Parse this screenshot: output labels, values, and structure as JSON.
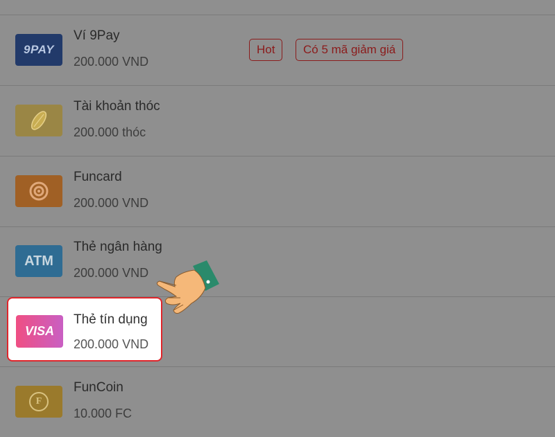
{
  "payment_methods": [
    {
      "name": "Ví 9Pay",
      "amount": "200.000 VND",
      "logo_text": "9PAY",
      "icon": "9pay-logo-icon",
      "badges": [
        "Hot",
        "Có 5 mã giảm giá"
      ]
    },
    {
      "name": "Tài khoản thóc",
      "amount": "200.000 thóc",
      "icon": "rice-grain-icon"
    },
    {
      "name": "Funcard",
      "amount": "200.000 VND",
      "icon": "funcard-swirl-icon"
    },
    {
      "name": "Thẻ ngân hàng",
      "amount": "200.000 VND",
      "logo_text": "ATM",
      "icon": "atm-logo-icon"
    },
    {
      "name": "Thẻ tín dụng",
      "amount": "200.000 VND",
      "logo_text": "VISA",
      "icon": "visa-logo-icon",
      "highlighted": true
    },
    {
      "name": "FunCoin",
      "amount": "10.000 FC",
      "logo_text": "F",
      "icon": "funcoin-icon"
    }
  ],
  "colors": {
    "highlight_border": "#e0252b",
    "badge_red": "#8b1b1b",
    "overlay": "#8f8f8f"
  },
  "pointer_icon": "pointing-hand-icon"
}
